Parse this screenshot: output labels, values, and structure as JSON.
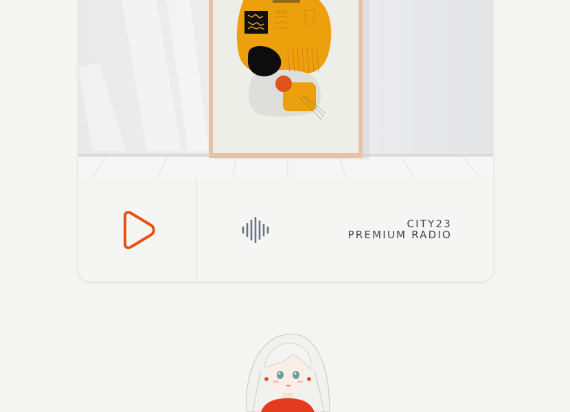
{
  "player": {
    "artwork": {
      "description_icon": "framed-abstract-art-image"
    },
    "play_button": {
      "icon": "play-icon",
      "color": "#e8510f"
    },
    "visualizer": {
      "icon": "audio-wave-icon",
      "color": "#6a7388"
    },
    "station": {
      "name": "CITY23",
      "tagline": "PREMIUM RADIO"
    }
  },
  "avatar": {
    "icon": "anime-girl-avatar"
  }
}
